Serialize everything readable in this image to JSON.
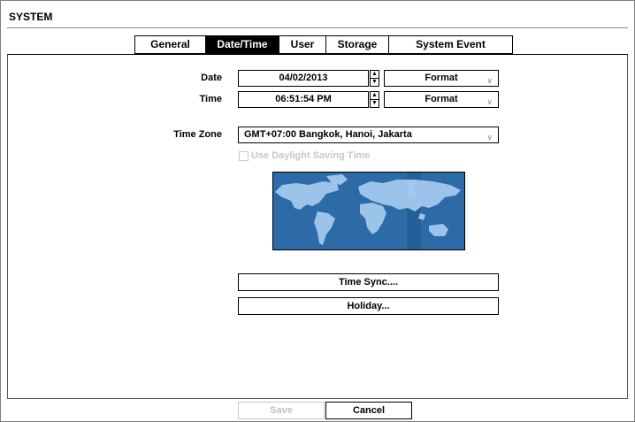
{
  "window": {
    "title": "SYSTEM"
  },
  "tabs": [
    {
      "label": "General",
      "active": false
    },
    {
      "label": "Date/Time",
      "active": true
    },
    {
      "label": "User",
      "active": false
    },
    {
      "label": "Storage",
      "active": false
    },
    {
      "label": "System Event",
      "active": false
    }
  ],
  "date": {
    "label": "Date",
    "value": "04/02/2013",
    "format_label": "Format"
  },
  "time": {
    "label": "Time",
    "value": "06:51:54 PM",
    "format_label": "Format"
  },
  "timezone": {
    "label": "Time Zone",
    "value": "GMT+07:00  Bangkok, Hanoi, Jakarta"
  },
  "daylight_saving": {
    "label": "Use Daylight Saving Time",
    "checked": false,
    "enabled": false
  },
  "buttons": {
    "time_sync": "Time Sync....",
    "holiday": "Holiday...",
    "save": "Save",
    "cancel": "Cancel"
  },
  "icons": {
    "spin_up": "up-arrow-icon",
    "spin_down": "down-arrow-icon",
    "dropdown": "chevron-down-icon"
  },
  "colors": {
    "map_ocean": "#2d6aa8",
    "map_land": "#9cc3ea",
    "map_highlight": "#9fc9ee",
    "active_tab_bg": "#000000"
  }
}
